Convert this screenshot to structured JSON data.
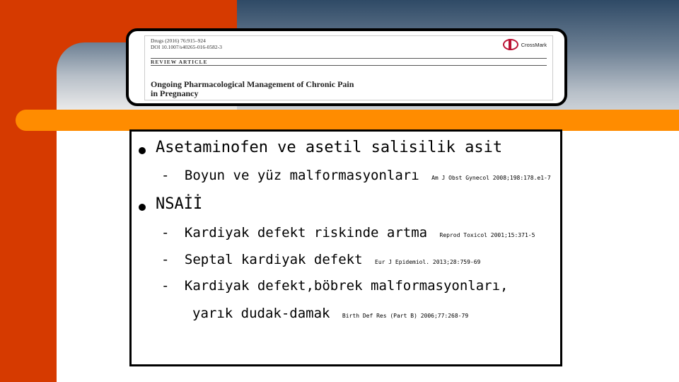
{
  "banner": {
    "journal_line1": "Drugs (2016) 76:915–924",
    "journal_line2": "DOI 10.1007/s40265-016-0582-3",
    "crossmark": "CrossMark",
    "article_type": "REVIEW ARTICLE",
    "title_line1": "Ongoing Pharmacological Management of Chronic Pain",
    "title_line2": "in Pregnancy"
  },
  "bullets": [
    {
      "text": "Asetaminofen ve asetil salisilik asit",
      "subs": [
        {
          "text": "Boyun ve yüz malformasyonları",
          "ref": "Am J Obst Gynecol 2008;198:178.e1-7"
        }
      ]
    },
    {
      "text": "NSAİİ",
      "subs": [
        {
          "text": "Kardiyak defekt riskinde artma",
          "ref": "Reprod Toxicol 2001;15:371-5"
        },
        {
          "text": "Septal kardiyak defekt",
          "ref": "Eur J Epidemiol. 2013;28:759-69"
        },
        {
          "text": "Kardiyak defekt,böbrek malformasyonları,",
          "ref": ""
        },
        {
          "text": "yarık dudak-damak",
          "ref": "Birth Def Res (Part B) 2006;77:268-79"
        }
      ]
    }
  ],
  "dash": "-"
}
